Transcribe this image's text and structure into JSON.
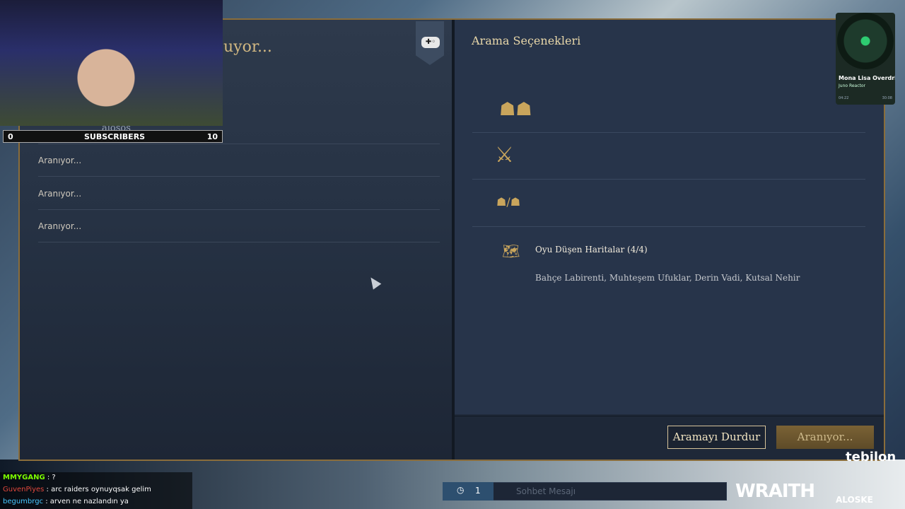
{
  "game": {
    "panel_title": "uyor...",
    "header_player": "alosos",
    "search_rows": [
      "Aranıyor...",
      "Aranıyor...",
      "Aranıyor..."
    ],
    "controller_glyph": "✚◦"
  },
  "search_options": {
    "title": "Arama Seçenekleri",
    "maps_title": "Oyu Düşen Haritalar (4/4)",
    "maps_list": "Bahçe Labirenti, Muhteşem Ufuklar, Derin Vadi, Kutsal Nehir",
    "icons": [
      "party-icon",
      "crossed-swords-icon",
      "team-vs-team-icon",
      "map-icon"
    ]
  },
  "buttons": {
    "stop_search": "Aramayı Durdur",
    "searching": "Aranıyor..."
  },
  "overlay": {
    "subscribers_label": "SUBSCRIBERS",
    "subscribers_current": "0",
    "subscribers_goal": "10",
    "music_title": "Mona Lisa Overdrive",
    "music_artist": "Juno Reactor",
    "music_elapsed": "04:22",
    "music_total": "30:08",
    "sponsor": "tebilon",
    "brand": "WRAITH",
    "code_label": "ALOSKE"
  },
  "stream_chat": [
    {
      "user": "MMYGANG",
      "msg": " : ?",
      "color": "green"
    },
    {
      "user": "GuvenPiyes",
      "msg": " : arc raiders oynuyqsak gelim",
      "color": "red"
    },
    {
      "user": "begumbrgc",
      "msg": " : arven ne nazlandın ya",
      "color": "cyan"
    }
  ],
  "game_chat": {
    "party_count": "1",
    "placeholder": "Sohbet Mesajı"
  },
  "colors": {
    "gold_accent": "#c9a55c",
    "panel_bg": "#27344a",
    "frame_border": "#8a6d3b"
  }
}
